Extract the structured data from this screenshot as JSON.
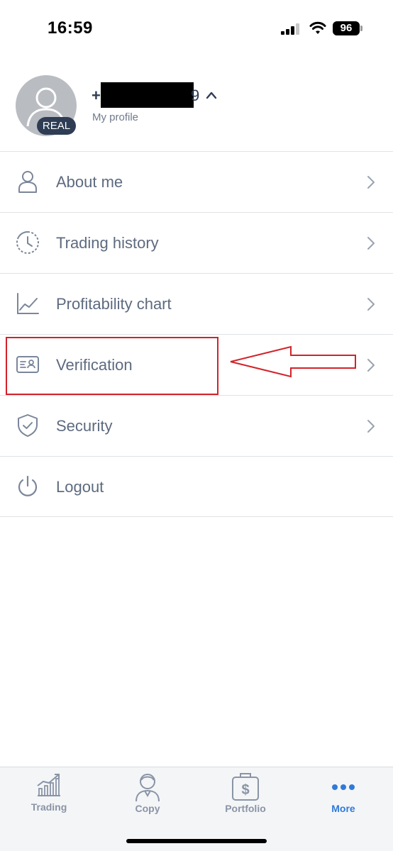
{
  "status_bar": {
    "time": "16:59",
    "battery": "96"
  },
  "profile": {
    "badge": "REAL",
    "phone_prefix": "+",
    "phone_suffix": "9",
    "subtitle": "My profile"
  },
  "menu": {
    "items": [
      {
        "label": "About me",
        "icon": "user-outline-icon"
      },
      {
        "label": "Trading history",
        "icon": "clock-history-icon"
      },
      {
        "label": "Profitability chart",
        "icon": "line-chart-icon"
      },
      {
        "label": "Verification",
        "icon": "id-card-icon"
      },
      {
        "label": "Security",
        "icon": "shield-check-icon"
      },
      {
        "label": "Logout",
        "icon": "power-icon"
      }
    ]
  },
  "annotation": {
    "color": "#d2232a",
    "target": "Verification"
  },
  "tab_bar": {
    "tabs": [
      {
        "label": "Trading",
        "icon": "trading-chart-icon",
        "active": false
      },
      {
        "label": "Copy",
        "icon": "copy-trader-icon",
        "active": false
      },
      {
        "label": "Portfolio",
        "icon": "portfolio-dollar-icon",
        "active": false
      },
      {
        "label": "More",
        "icon": "more-dots-icon",
        "active": true
      }
    ],
    "active_color": "#2f7ad9",
    "inactive_color": "#8a94a6"
  }
}
